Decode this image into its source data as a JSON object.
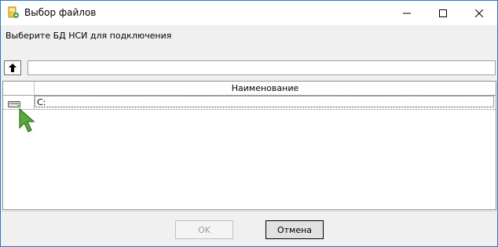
{
  "window": {
    "title": "Выбор файлов",
    "accent_color": "#2b78c6"
  },
  "prompt": "Выберите БД НСИ для подключения",
  "toolbar": {
    "up_icon": "arrow-up-icon",
    "path_value": ""
  },
  "grid": {
    "columns": [
      "Наименование"
    ],
    "rows": [
      {
        "icon": "drive-icon",
        "name": "C:"
      }
    ]
  },
  "buttons": {
    "ok_label": "OK",
    "cancel_label": "Отмена"
  }
}
